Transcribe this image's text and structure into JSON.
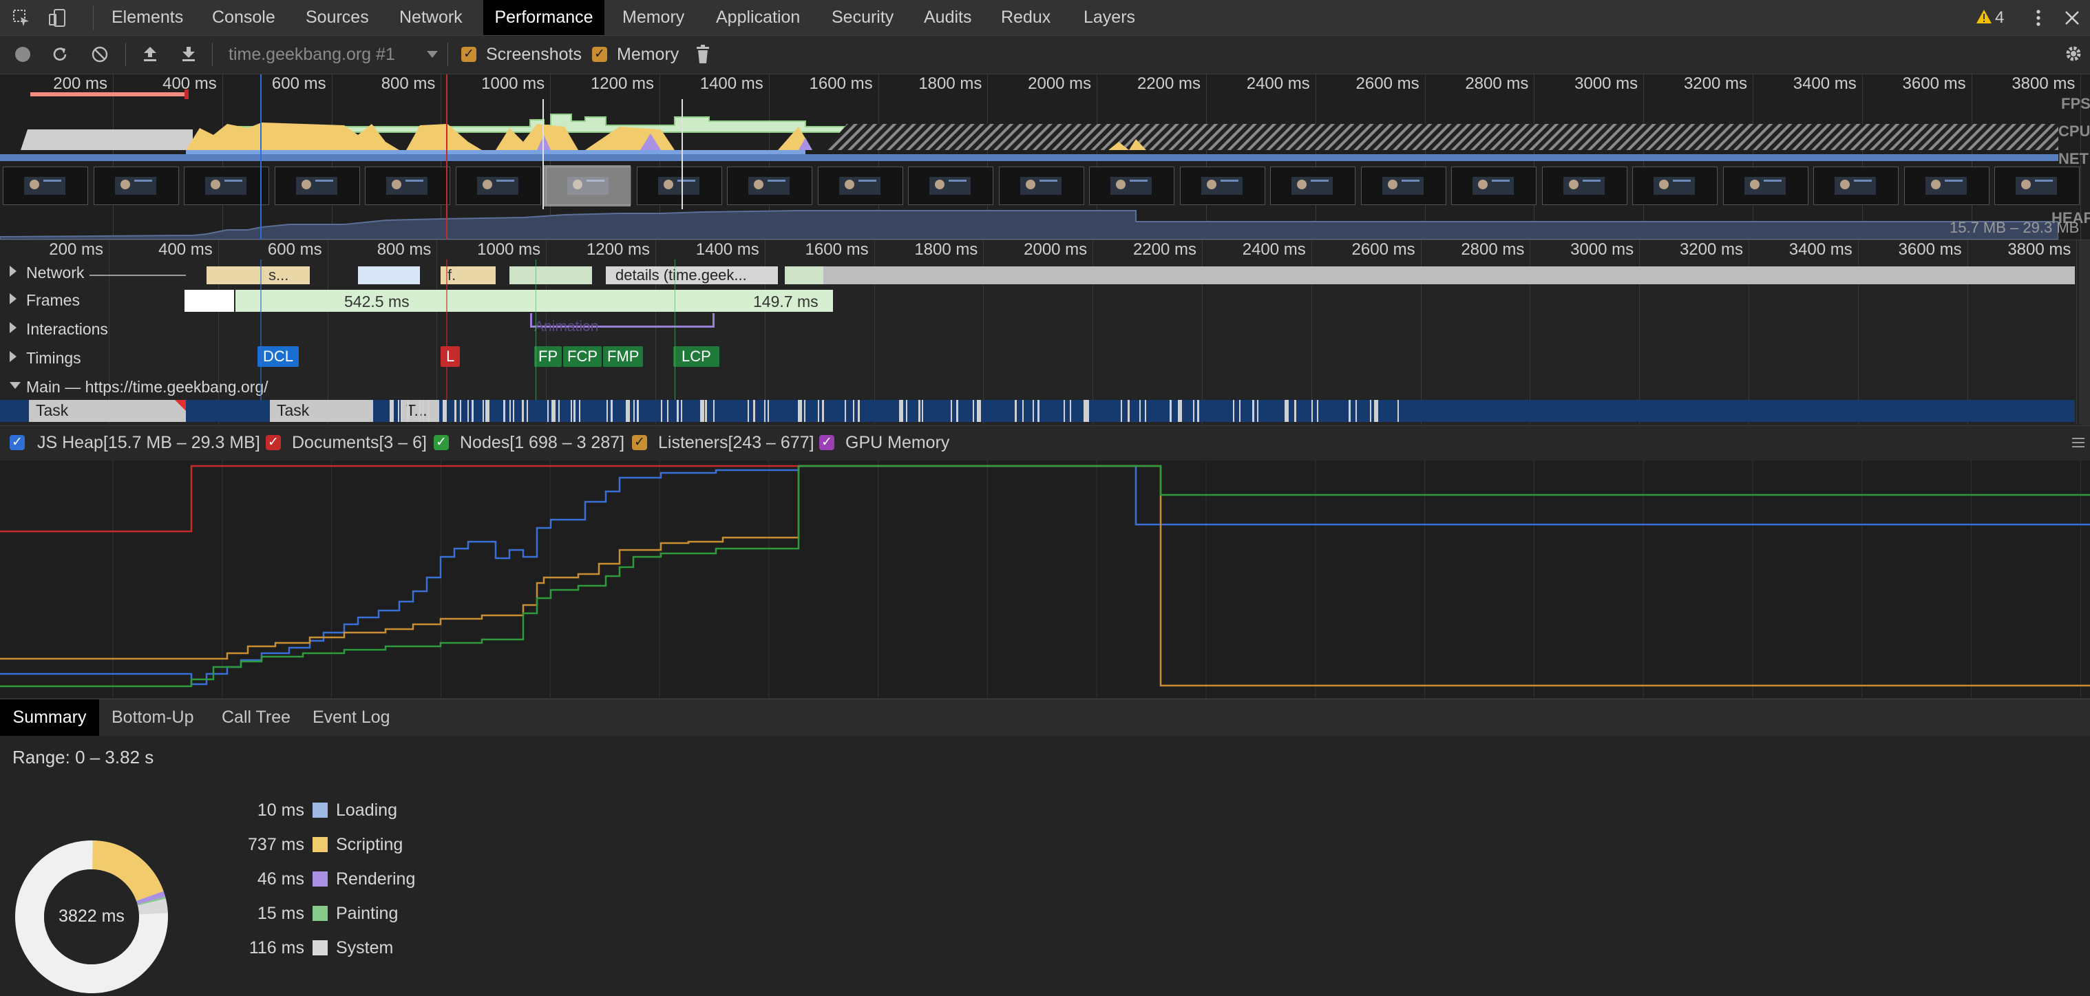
{
  "tabs": [
    "Elements",
    "Console",
    "Sources",
    "Network",
    "Performance",
    "Memory",
    "Application",
    "Security",
    "Audits",
    "Redux",
    "Layers"
  ],
  "active_tab": "Performance",
  "warning_count": "4",
  "toolbar": {
    "profile_select": "time.geekbang.org #1",
    "screenshots_label": "Screenshots",
    "memory_label": "Memory"
  },
  "overview": {
    "ticks": [
      "200 ms",
      "400 ms",
      "600 ms",
      "800 ms",
      "1000 ms",
      "1200 ms",
      "1400 ms",
      "1600 ms",
      "1800 ms",
      "2000 ms",
      "2200 ms",
      "2400 ms",
      "2600 ms",
      "2800 ms",
      "3000 ms",
      "3200 ms",
      "3400 ms",
      "3600 ms",
      "3800 ms"
    ],
    "side_labels": {
      "fps": "FPS",
      "cpu": "CPU",
      "net": "NET",
      "heap": "HEAP"
    },
    "heap_range": "15.7 MB – 29.3 MB"
  },
  "tracks": {
    "ticks": [
      "200 ms",
      "400 ms",
      "600 ms",
      "800 ms",
      "1000 ms",
      "1200 ms",
      "1400 ms",
      "1600 ms",
      "1800 ms",
      "2000 ms",
      "2200 ms",
      "2400 ms",
      "2600 ms",
      "2800 ms",
      "3000 ms",
      "3200 ms",
      "3400 ms",
      "3600 ms",
      "3800 ms"
    ],
    "network_label": "Network",
    "network_items": [
      "s...",
      "f.",
      "details (time.geek..."
    ],
    "frames_label": "Frames",
    "frames": [
      "542.5 ms",
      "149.7 ms"
    ],
    "interactions_label": "Interactions",
    "interaction_item": "Animation",
    "timings_label": "Timings",
    "timings": [
      "DCL",
      "L",
      "FP",
      "FCP",
      "FMP",
      "LCP"
    ],
    "main_label": "Main — https://time.geekbang.org/",
    "main_tasks": [
      "Task",
      "Task",
      "T..."
    ]
  },
  "memory_legend": [
    {
      "label": "JS Heap[15.7 MB – 29.3 MB]",
      "color": "#3b6fd8"
    },
    {
      "label": "Documents[3 – 6]",
      "color": "#c62b2b"
    },
    {
      "label": "Nodes[1 698 – 3 287]",
      "color": "#2e9a3c"
    },
    {
      "label": "Listeners[243 – 677]",
      "color": "#c98d32"
    },
    {
      "label": "GPU Memory",
      "color": "#9b3fb5"
    }
  ],
  "bottom_tabs": [
    "Summary",
    "Bottom-Up",
    "Call Tree",
    "Event Log"
  ],
  "summary": {
    "range": "Range: 0 – 3.82 s",
    "total": "3822 ms",
    "rows": [
      {
        "value": "10 ms",
        "label": "Loading",
        "color": "#9fb9e6"
      },
      {
        "value": "737 ms",
        "label": "Scripting",
        "color": "#f2cb6d"
      },
      {
        "value": "46 ms",
        "label": "Rendering",
        "color": "#a991e3"
      },
      {
        "value": "15 ms",
        "label": "Painting",
        "color": "#86c98a"
      },
      {
        "value": "116 ms",
        "label": "System",
        "color": "#d9d9d9"
      }
    ]
  }
}
